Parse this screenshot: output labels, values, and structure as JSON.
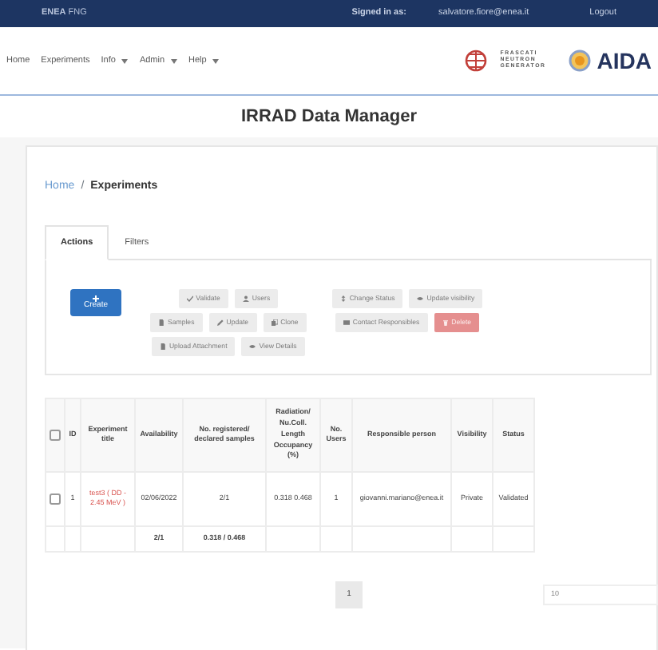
{
  "top_bar": {
    "brand": "**ENEA** FNG",
    "signed_in_label": "Signed in as:",
    "user": "salvatore.fiore@enea.it",
    "logout": "Logout"
  },
  "nav": [
    {
      "label": "Home",
      "dropdown": false
    },
    {
      "label": "Experiments",
      "dropdown": false
    },
    {
      "label": "Info",
      "dropdown": true
    },
    {
      "label": "Admin",
      "dropdown": true
    },
    {
      "label": "Help",
      "dropdown": true
    }
  ],
  "logos": {
    "fng_lines": [
      "FRASCATI",
      "NEUTRON",
      "GENERATOR"
    ],
    "aida": "AIDA"
  },
  "title": "IRRAD Data Manager",
  "breadcrumb_separator": "/",
  "breadcrumb": [
    {
      "label": "Home",
      "current": false
    },
    {
      "label": "Experiments",
      "current": true
    }
  ],
  "tabs": [
    {
      "label": "Actions",
      "selected": true
    },
    {
      "label": "Filters",
      "selected": false
    }
  ],
  "create_button": {
    "label": "Create",
    "disabled": false
  },
  "button_groups": [
    [
      [
        {
          "label": "Validate",
          "kind": "secondary",
          "disabled": true
        },
        {
          "label": "Users",
          "kind": "secondary",
          "disabled": true
        }
      ],
      [
        {
          "label": "Samples",
          "kind": "secondary",
          "disabled": true
        },
        {
          "label": "Update",
          "kind": "secondary",
          "disabled": true
        },
        {
          "label": "Clone",
          "kind": "secondary",
          "disabled": true
        }
      ],
      [
        {
          "label": "Upload Attachment",
          "kind": "secondary",
          "disabled": true
        },
        {
          "label": "View Details",
          "kind": "secondary",
          "disabled": true
        }
      ]
    ],
    [
      [
        {
          "label": "Change Status",
          "kind": "secondary",
          "disabled": true
        },
        {
          "label": "Update visibility",
          "kind": "secondary",
          "disabled": true
        }
      ],
      [
        {
          "label": "Contact Responsibles",
          "kind": "secondary",
          "disabled": true
        },
        {
          "label": "Delete",
          "kind": "danger",
          "disabled": true
        }
      ]
    ]
  ],
  "table": {
    "header_checkbox": {
      "checked": false
    },
    "columns": [
      "ID",
      "Experiment title",
      "Availability",
      "No. registered/ declared samples",
      "Radiation/ Nu.Coll. Length Occupancy (%)",
      "No. Users",
      "Responsible person",
      "Visibility",
      "Status"
    ],
    "rows": [
      {
        "checked": false,
        "cells": [
          "1",
          "test3 ( DD - 2.45 MeV )",
          "02/06/2022",
          "2/1",
          "0.318 0.468",
          "1",
          "giovanni.mariano@enea.it",
          "Private",
          "Validated"
        ]
      }
    ],
    "totals": {
      "availability": "2/1",
      "samples": "0.318 / 0.468"
    }
  },
  "pagination": {
    "pages": [
      {
        "label": "1",
        "selected": true
      }
    ],
    "page_size": "10"
  }
}
